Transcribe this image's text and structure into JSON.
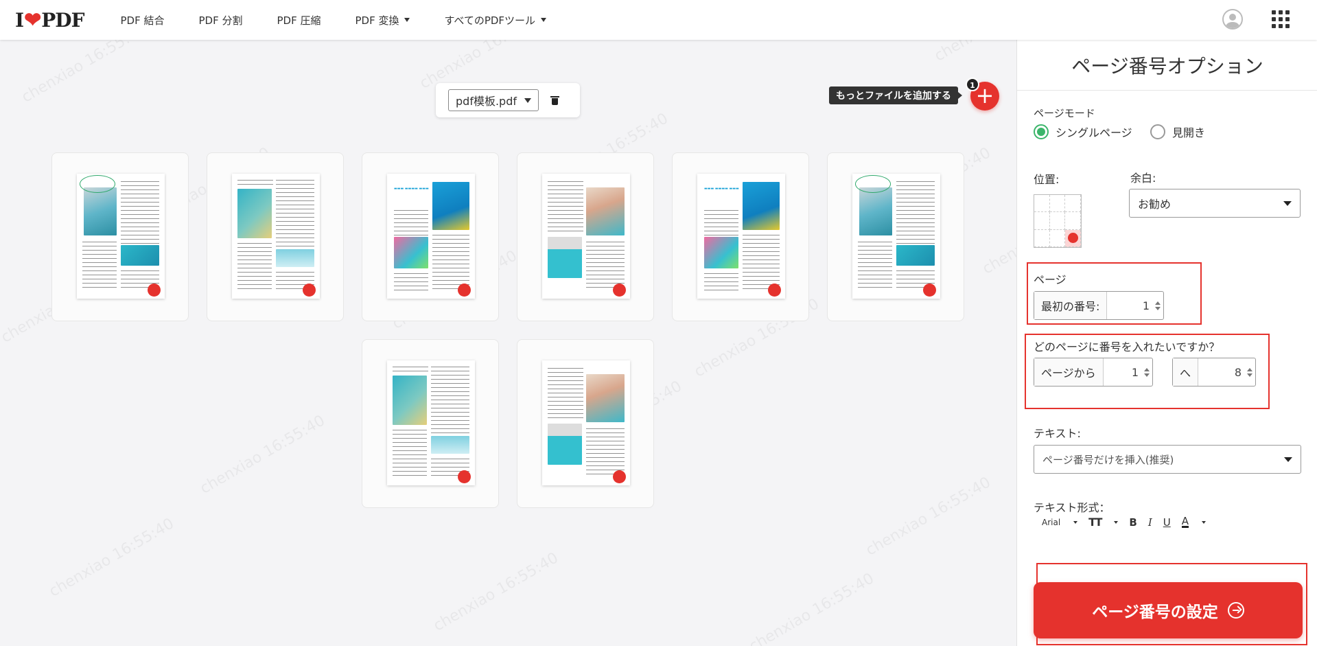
{
  "header": {
    "logo_prefix": "I",
    "logo_suffix": "PDF",
    "nav": [
      {
        "label": "PDF 結合",
        "dropdown": false
      },
      {
        "label": "PDF 分割",
        "dropdown": false
      },
      {
        "label": "PDF 圧縮",
        "dropdown": false
      },
      {
        "label": "PDF 変換",
        "dropdown": true
      },
      {
        "label": "すべてのPDFツール",
        "dropdown": true
      }
    ],
    "icons": [
      "user-avatar-icon",
      "apps-grid-icon"
    ]
  },
  "watermark": {
    "user": "chenxiao",
    "time": "16:55:40"
  },
  "workspace": {
    "file_select_value": "pdf模板.pdf",
    "add_tooltip": "もっとファイルを追加する",
    "add_badge": "1",
    "pages": [
      "page-1",
      "page-2",
      "page-3",
      "page-4",
      "page-5",
      "page-6",
      "page-7",
      "page-8"
    ]
  },
  "panel": {
    "title": "ページ番号オプション",
    "page_mode_label": "ページモード",
    "mode_single": "シングルページ",
    "mode_spread": "見開き",
    "position_label": "位置:",
    "margin_label": "余白:",
    "margin_value": "お勧め",
    "page_section_label": "ページ",
    "first_number_prefix": "最初の番号:",
    "first_number_value": "1",
    "range_question": "どのページに番号を入れたいですか？",
    "range_from_prefix": "ページから",
    "range_from_value": "1",
    "range_to_prefix": "へ",
    "range_to_value": "8",
    "text_label": "テキスト:",
    "text_value": "ページ番号だけを挿入(推奨)",
    "text_format_label": "テキスト形式：",
    "font_value": "Arial",
    "size_glyph": "TT",
    "bold_glyph": "B",
    "italic_glyph": "I",
    "underline_glyph": "U",
    "color_glyph": "A",
    "submit_label": "ページ番号の設定"
  },
  "colors": {
    "accent": "#e5322d",
    "radio_on": "#3bb56a"
  }
}
